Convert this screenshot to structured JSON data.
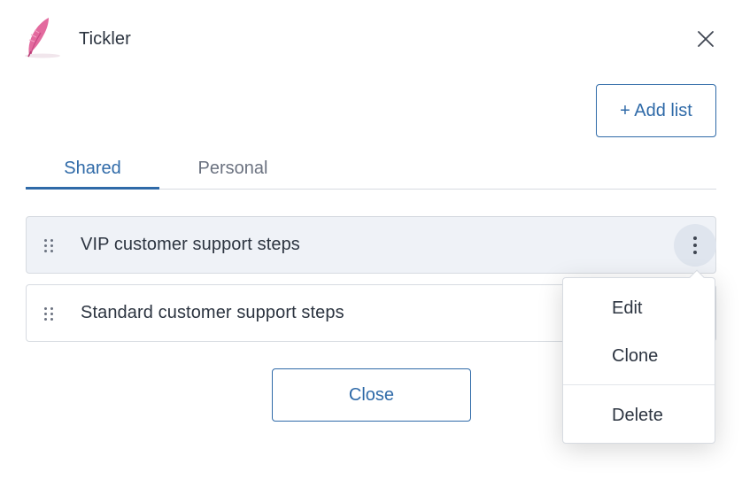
{
  "header": {
    "title": "Tickler",
    "logo_icon": "feather-icon",
    "close_icon": "close-icon"
  },
  "toolbar": {
    "add_list_label": "+ Add list"
  },
  "tabs": [
    {
      "label": "Shared",
      "active": true
    },
    {
      "label": "Personal",
      "active": false
    }
  ],
  "lists": [
    {
      "label": "VIP customer support steps",
      "highlighted": true
    },
    {
      "label": "Standard customer support steps",
      "highlighted": false
    }
  ],
  "context_menu": {
    "items": [
      {
        "label": "Edit"
      },
      {
        "label": "Clone"
      },
      {
        "label": "Delete"
      }
    ]
  },
  "footer": {
    "close_label": "Close"
  },
  "colors": {
    "accent": "#2f6aa8",
    "text": "#2c3440",
    "muted": "#6b7280",
    "row_highlight": "#eff2f7",
    "logo": "#e0609a"
  }
}
